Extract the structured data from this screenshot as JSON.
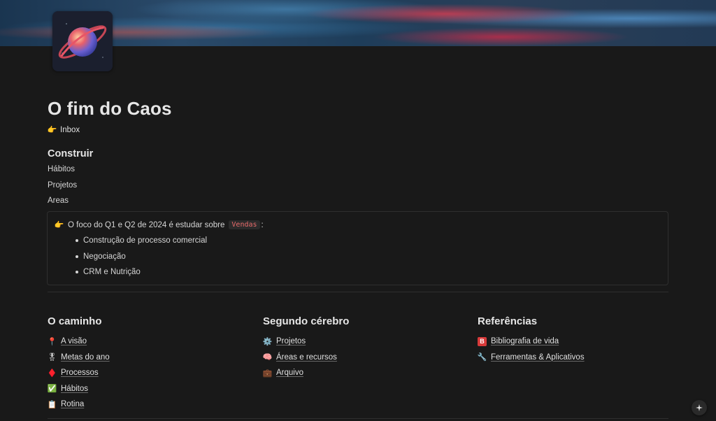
{
  "page": {
    "title": "O fim do Caos",
    "inbox_label": "Inbox"
  },
  "construir": {
    "heading": "Construir",
    "links": [
      "Hábitos",
      "Projetos",
      "Areas"
    ]
  },
  "callout": {
    "prefix": "O foco do Q1 e Q2 de 2024 é estudar sobre",
    "code": "Vendas",
    "suffix": ":",
    "bullets": [
      "Construção de processo comercial",
      "Negociação",
      "CRM e Nutrição"
    ]
  },
  "columns": {
    "caminho": {
      "heading": "O caminho",
      "items": [
        {
          "icon": "pin-icon",
          "label": "A visão"
        },
        {
          "icon": "medal-icon",
          "label": "Metas do ano"
        },
        {
          "icon": "red-diamond-icon",
          "label": "Processos"
        },
        {
          "icon": "check-icon",
          "label": "Hábitos"
        },
        {
          "icon": "clipboard-icon",
          "label": "Rotina"
        }
      ]
    },
    "cerebro": {
      "heading": "Segundo cérebro",
      "items": [
        {
          "icon": "gear-icon",
          "label": "Projetos"
        },
        {
          "icon": "brain-icon",
          "label": "Áreas e recursos"
        },
        {
          "icon": "briefcase-icon",
          "label": "Arquivo"
        }
      ]
    },
    "referencias": {
      "heading": "Referências",
      "items": [
        {
          "icon": "b-badge-icon",
          "label": "Bibliografia de vida"
        },
        {
          "icon": "wrench-icon",
          "label": "Ferramentas & Aplicativos"
        }
      ]
    }
  },
  "colors": {
    "background": "#191919",
    "text": "#d4d4d4",
    "code_text": "#e86b6b"
  }
}
